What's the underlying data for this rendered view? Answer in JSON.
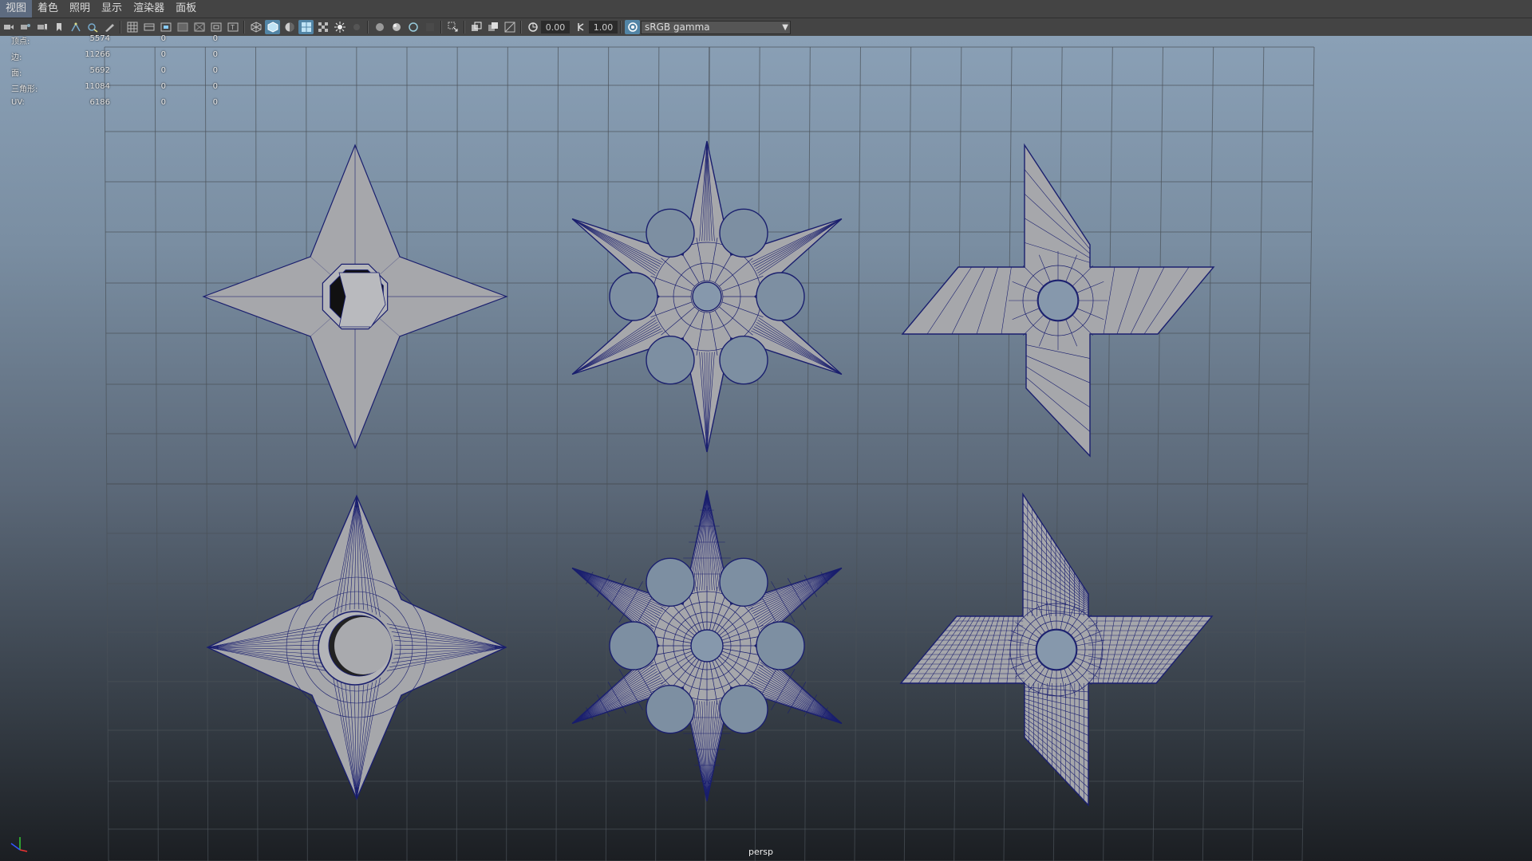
{
  "menu": [
    "视图",
    "着色",
    "照明",
    "显示",
    "渲染器",
    "面板"
  ],
  "toolbar": {
    "exposure_value": "0.00",
    "gamma_value": "1.00",
    "color_space": "sRGB gamma",
    "icons": [
      "select-camera-icon",
      "camera-attributes-icon",
      "bookmark-icon",
      "image-plane-icon",
      "grid-icon",
      "film-gate-icon",
      "resolution-gate-icon",
      "gate-mask-icon",
      "field-chart-icon",
      "safe-action-icon",
      "safe-title-icon",
      "wireframe-icon",
      "smooth-shade-icon",
      "default-material-icon",
      "textured-icon",
      "use-all-lights-icon",
      "shadows-icon",
      "screen-space-ao-icon",
      "motion-blur-icon",
      "anti-aliasing-icon",
      "depth-of-field-icon",
      "xray-icon",
      "xray-joints-icon",
      "isolate-select-icon",
      "exposure-icon",
      "gamma-icon",
      "color-management-icon"
    ]
  },
  "hud": {
    "rows": [
      {
        "label": "顶点:",
        "v1": "5574",
        "v2": "0",
        "v3": "0"
      },
      {
        "label": "边:",
        "v1": "11266",
        "v2": "0",
        "v3": "0"
      },
      {
        "label": "面:",
        "v1": "5692",
        "v2": "0",
        "v3": "0"
      },
      {
        "label": "三角形:",
        "v1": "11084",
        "v2": "0",
        "v3": "0"
      },
      {
        "label": "UV:",
        "v1": "6186",
        "v2": "0",
        "v3": "0"
      }
    ]
  },
  "camera_label": "persp",
  "colors": {
    "wire": "#1a1f6e",
    "surface": "#a6a7ab",
    "grid": "#4a5158",
    "axis": "#222222"
  }
}
